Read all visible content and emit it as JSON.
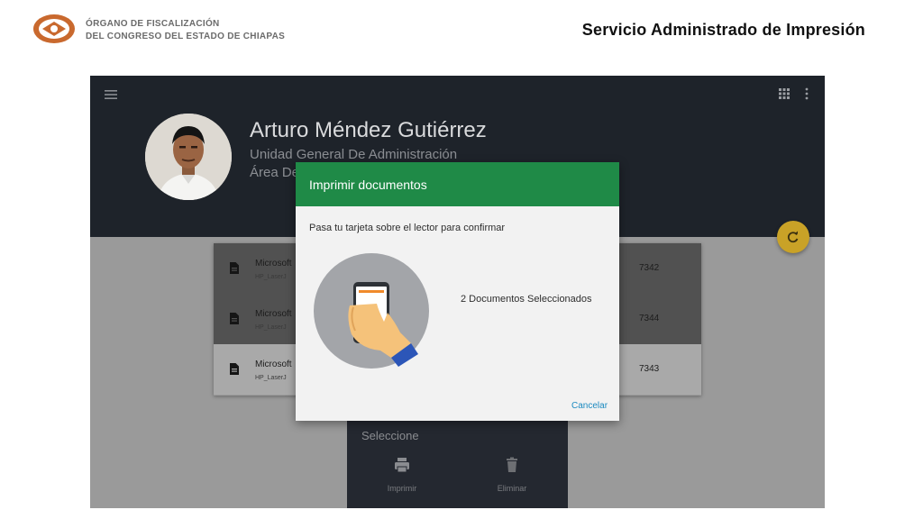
{
  "header": {
    "org_line1": "ÓRGANO DE FISCALIZACIÓN",
    "org_line2": "DEL CONGRESO DEL ESTADO DE CHIAPAS",
    "slide_title": "Servicio Administrado de Impresión"
  },
  "icons": {
    "menu": "menu-icon",
    "grid": "grid-icon",
    "more": "more-vertical-icon",
    "refresh": "refresh-icon",
    "document": "document-icon",
    "print": "printer-icon",
    "delete": "trash-icon"
  },
  "user": {
    "name": "Arturo Méndez Gutiérrez",
    "unit": "Unidad General De Administración",
    "area": "Área De"
  },
  "jobs": [
    {
      "title": "Microsoft",
      "printer": "HP_LaserJ",
      "id": "7342",
      "selected": true
    },
    {
      "title": "Microsoft",
      "printer": "HP_LaserJ",
      "id": "7344",
      "selected": true
    },
    {
      "title": "Microsoft",
      "printer": "HP_LaserJ",
      "id": "7343",
      "selected": false
    }
  ],
  "bottom_sheet": {
    "title": "Seleccione",
    "print_label": "Imprimir",
    "delete_label": "Eliminar"
  },
  "dialog": {
    "title": "Imprimir documentos",
    "message": "Pasa tu tarjeta sobre el lector para confirmar",
    "doc_count": "2  Documentos Seleccionados",
    "cancel": "Cancelar"
  },
  "colors": {
    "dialog_header": "#1f8a47",
    "app_bar": "#1e232a",
    "accent_fab": "#c9a227",
    "link": "#1b8ac0"
  }
}
